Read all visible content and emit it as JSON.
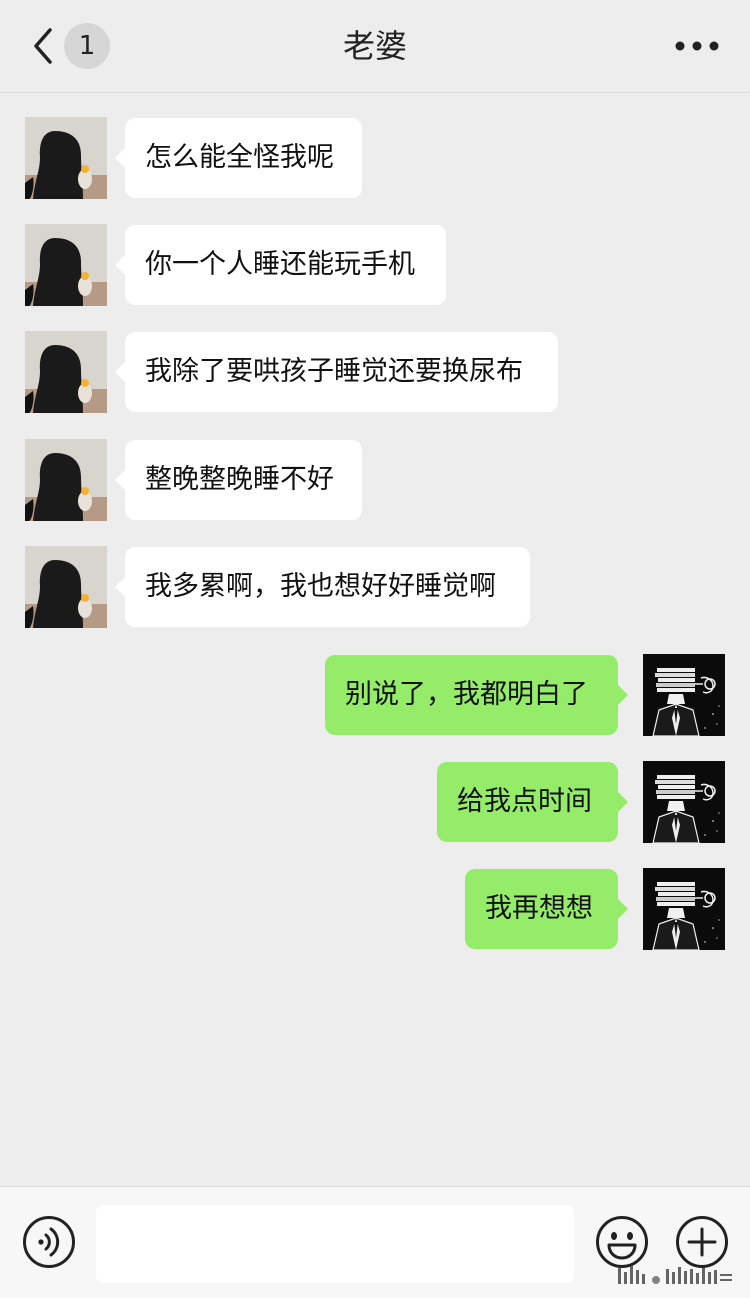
{
  "header": {
    "back_label": "back",
    "unread_count": "1",
    "title": "老婆",
    "more_label": "more"
  },
  "messages": [
    {
      "side": "in",
      "text": "怎么能全怪我呢"
    },
    {
      "side": "in",
      "text": "你一个人睡还能玩手机"
    },
    {
      "side": "in",
      "text": "我除了要哄孩子睡觉还要换尿布"
    },
    {
      "side": "in",
      "text": "整晚整晚睡不好"
    },
    {
      "side": "in",
      "text": "我多累啊，我也想好好睡觉啊"
    },
    {
      "side": "out",
      "text": "别说了，我都明白了"
    },
    {
      "side": "out",
      "text": "给我点时间"
    },
    {
      "side": "out",
      "text": "我再想想"
    }
  ],
  "input": {
    "value": "",
    "placeholder": ""
  },
  "icons": {
    "back": "chevron-left-icon",
    "more": "more-dots-icon",
    "voice": "voice-icon",
    "emoji": "emoji-icon",
    "plus": "plus-icon"
  },
  "colors": {
    "background": "#ededed",
    "incoming_bubble": "#ffffff",
    "outgoing_bubble": "#95ec69",
    "text": "#111111"
  }
}
